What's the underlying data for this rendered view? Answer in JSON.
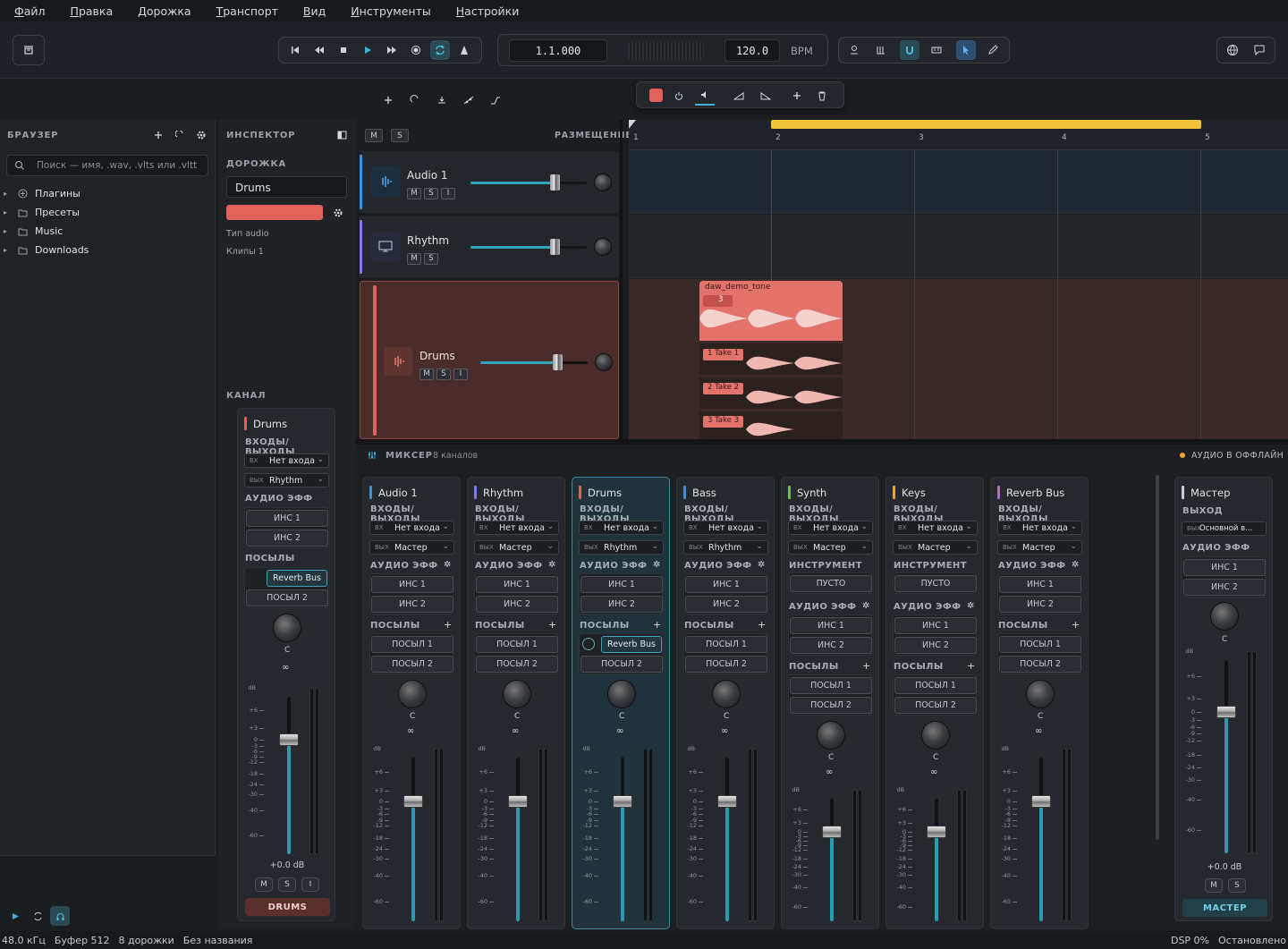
{
  "menu": [
    "Файл",
    "Правка",
    "Дорожка",
    "Транспорт",
    "Вид",
    "Инструменты",
    "Настройки"
  ],
  "transport": {
    "position": "1.1.000",
    "tempo": "120.0",
    "bpm_label": "BPM"
  },
  "browser": {
    "title": "БРАУЗЕР",
    "search_placeholder": "Поиск — имя, .wav, .vlts или .vltt",
    "items": [
      "Плагины",
      "Пресеты",
      "Music",
      "Downloads"
    ]
  },
  "inspector": {
    "title": "ИНСПЕКТОР",
    "track_section": "ДОРОЖКА",
    "track_name": "Drums",
    "track_color": "#e0625a",
    "type_label": "Тип audio",
    "clips_label": "Клипы 1",
    "channel_section": "КАНАЛ"
  },
  "arrangement": {
    "m": "M",
    "s": "S",
    "placement": "РАЗМЕЩЕНИЕ",
    "bars": [
      "1",
      "2",
      "3",
      "4",
      "5"
    ]
  },
  "tracks": [
    {
      "name": "Audio 1",
      "color": "#3f8fd6",
      "volume": 0.72,
      "buttons": [
        "M",
        "S",
        "I"
      ]
    },
    {
      "name": "Rhythm",
      "color": "#7b7fe0",
      "volume": 0.72,
      "buttons": [
        "M",
        "S"
      ]
    },
    {
      "name": "Drums",
      "color": "#e0625a",
      "volume": 0.72,
      "buttons": [
        "M",
        "S",
        "I"
      ]
    }
  ],
  "clip": {
    "name": "daw_demo_tone",
    "comp_count": "3",
    "takes": [
      "1  Take 1",
      "2  Take 2",
      "3  Take 3"
    ]
  },
  "mixer": {
    "title": "МИКСЕР",
    "count": "8 каналов",
    "offline": "АУДИО В ОФФЛАЙН"
  },
  "labels": {
    "io": "ВХОДЫ/ВЫХОДЫ",
    "fx": "АУДИО ЭФФ",
    "sends": "ПОСЫЛЫ",
    "instrument": "ИНСТРУМЕНТ",
    "in": "ВХ",
    "out": "ВЫХ",
    "ins1": "ИНС 1",
    "ins2": "ИНС 2",
    "send1": "ПОСЫЛ 1",
    "send2": "ПОСЫЛ 2",
    "empty": "ПУСТО",
    "pan": "C",
    "output": "ВЫХОД"
  },
  "db_scale": [
    "dB",
    "+6",
    "+3",
    "0",
    "-3",
    "-6",
    "-9",
    "-12",
    "-18",
    "-24",
    "-30",
    "-40",
    "-60"
  ],
  "strips": [
    {
      "name": "Audio 1",
      "color": "#3f8fd6",
      "input": "Нет входа",
      "output": "Мастер",
      "instrument": false,
      "send": "",
      "fader": 0.72
    },
    {
      "name": "Rhythm",
      "color": "#7b7fe0",
      "input": "Нет входа",
      "output": "Мастер",
      "instrument": false,
      "send": "",
      "fader": 0.72
    },
    {
      "name": "Drums",
      "color": "#e0625a",
      "input": "Нет входа",
      "output": "Rhythm",
      "instrument": false,
      "send": "Reverb Bus",
      "fader": 0.72,
      "selected": true
    },
    {
      "name": "Bass",
      "color": "#3f8fd6",
      "input": "Нет входа",
      "output": "Rhythm",
      "instrument": false,
      "send": "",
      "fader": 0.72
    },
    {
      "name": "Synth",
      "color": "#6cc04a",
      "input": "Нет входа",
      "output": "Мастер",
      "instrument": true,
      "send": "",
      "fader": 0.72
    },
    {
      "name": "Keys",
      "color": "#e8a040",
      "input": "Нет входа",
      "output": "Мастер",
      "instrument": true,
      "send": "",
      "fader": 0.72
    },
    {
      "name": "Reverb Bus",
      "color": "#b06ad8",
      "input": "Нет входа",
      "output": "Мастер",
      "instrument": false,
      "send": "",
      "fader": 0.72
    }
  ],
  "channel": {
    "name": "Drums",
    "input": "Нет входа",
    "output": "Rhythm",
    "send": "Reverb Bus",
    "gain": "+0.0 dB",
    "label": "DRUMS",
    "buttons": [
      "M",
      "S",
      "I"
    ]
  },
  "master": {
    "name": "Мастер",
    "output": "Основной в...",
    "gain": "+0.0 dB",
    "label": "МАСТЕР",
    "buttons": [
      "M",
      "S"
    ]
  },
  "status": {
    "rate": "48.0 кГц",
    "buffer": "Буфер 512",
    "tracks": "8 дорожки",
    "project": "Без названия",
    "dsp": "DSP 0%",
    "state": "Остановлено"
  }
}
